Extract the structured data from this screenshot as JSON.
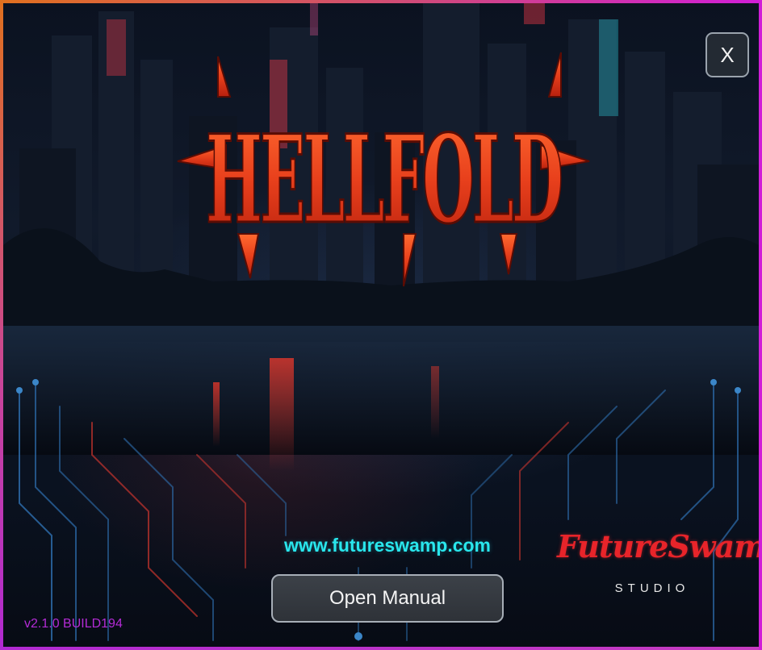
{
  "app": {
    "title": "HELLFOLD"
  },
  "header": {
    "close_label": "X"
  },
  "links": {
    "website": "www.futureswamp.com"
  },
  "actions": {
    "open_manual_label": "Open Manual"
  },
  "studio": {
    "name": "FutureSwamp",
    "subtitle": "STUDIO"
  },
  "footer": {
    "version": "v2.1.0 BUILD194"
  },
  "colors": {
    "title_red": "#e84420",
    "link_cyan": "#29e6ec",
    "studio_red": "#e8242a",
    "version_purple": "#b42bd6",
    "frame_orange": "#e0701f",
    "frame_magenta": "#d11ed8"
  },
  "icons": {
    "close": "x-glyph"
  }
}
